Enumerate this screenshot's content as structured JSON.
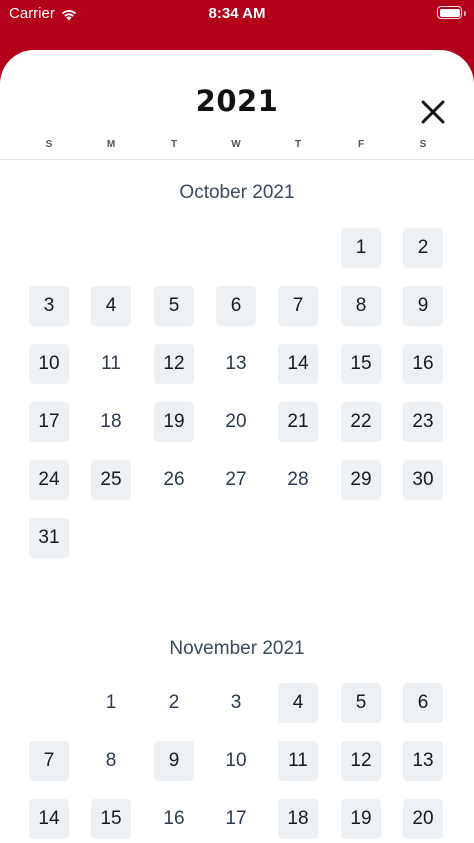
{
  "status_bar": {
    "carrier": "Carrier",
    "time": "8:34 AM"
  },
  "header": {
    "year": "2021",
    "close_icon": "close-icon"
  },
  "weekdays": [
    "S",
    "M",
    "T",
    "W",
    "T",
    "F",
    "S"
  ],
  "colors": {
    "accent": "#b3001b",
    "available_bg": "#eef1f4",
    "text_muted": "#3b4a5e"
  },
  "months": [
    {
      "title": "October 2021",
      "first_weekday": 5,
      "days": [
        {
          "d": "1",
          "available": true
        },
        {
          "d": "2",
          "available": true
        },
        {
          "d": "3",
          "available": true
        },
        {
          "d": "4",
          "available": true
        },
        {
          "d": "5",
          "available": true
        },
        {
          "d": "6",
          "available": true
        },
        {
          "d": "7",
          "available": true
        },
        {
          "d": "8",
          "available": true
        },
        {
          "d": "9",
          "available": true
        },
        {
          "d": "10",
          "available": true
        },
        {
          "d": "11",
          "available": false
        },
        {
          "d": "12",
          "available": true
        },
        {
          "d": "13",
          "available": false
        },
        {
          "d": "14",
          "available": true
        },
        {
          "d": "15",
          "available": true
        },
        {
          "d": "16",
          "available": true
        },
        {
          "d": "17",
          "available": true
        },
        {
          "d": "18",
          "available": false
        },
        {
          "d": "19",
          "available": true
        },
        {
          "d": "20",
          "available": false
        },
        {
          "d": "21",
          "available": true
        },
        {
          "d": "22",
          "available": true
        },
        {
          "d": "23",
          "available": true
        },
        {
          "d": "24",
          "available": true
        },
        {
          "d": "25",
          "available": true
        },
        {
          "d": "26",
          "available": false
        },
        {
          "d": "27",
          "available": false
        },
        {
          "d": "28",
          "available": false
        },
        {
          "d": "29",
          "available": true
        },
        {
          "d": "30",
          "available": true
        },
        {
          "d": "31",
          "available": true
        }
      ]
    },
    {
      "title": "November 2021",
      "first_weekday": 1,
      "days": [
        {
          "d": "1",
          "available": false
        },
        {
          "d": "2",
          "available": false
        },
        {
          "d": "3",
          "available": false
        },
        {
          "d": "4",
          "available": true
        },
        {
          "d": "5",
          "available": true
        },
        {
          "d": "6",
          "available": true
        },
        {
          "d": "7",
          "available": true
        },
        {
          "d": "8",
          "available": false
        },
        {
          "d": "9",
          "available": true
        },
        {
          "d": "10",
          "available": false
        },
        {
          "d": "11",
          "available": true
        },
        {
          "d": "12",
          "available": true
        },
        {
          "d": "13",
          "available": true
        },
        {
          "d": "14",
          "available": true
        },
        {
          "d": "15",
          "available": true
        },
        {
          "d": "16",
          "available": false
        },
        {
          "d": "17",
          "available": false
        },
        {
          "d": "18",
          "available": true
        },
        {
          "d": "19",
          "available": true
        },
        {
          "d": "20",
          "available": true
        }
      ]
    }
  ]
}
